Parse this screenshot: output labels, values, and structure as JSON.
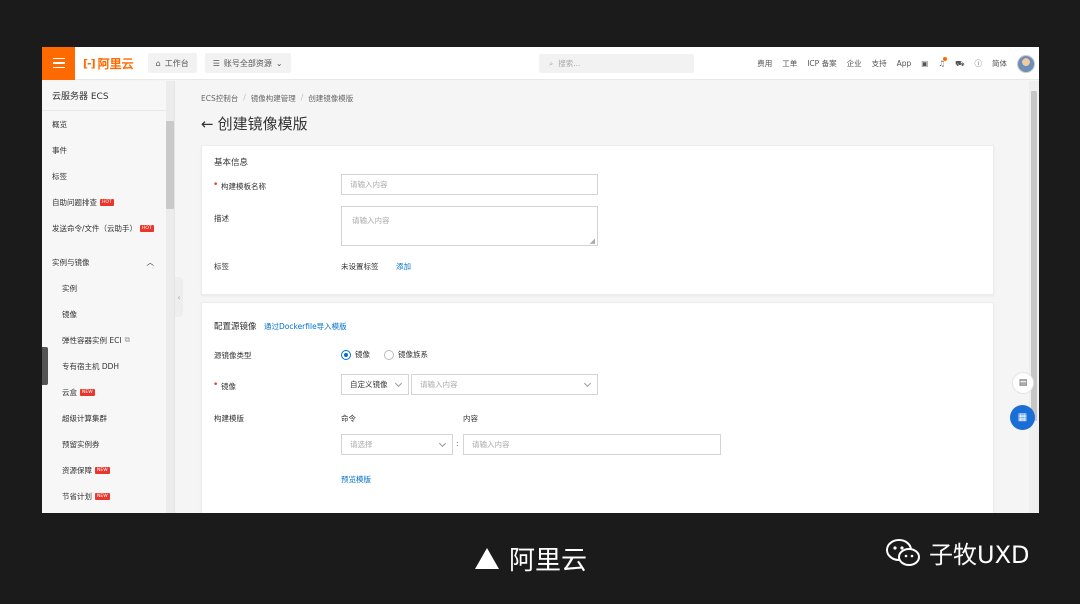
{
  "topbar": {
    "logo_text": "阿里云",
    "workbench": "工作台",
    "resources": "账号全部资源",
    "search_placeholder": "搜索...",
    "links": [
      "费用",
      "工单",
      "ICP 备案",
      "企业",
      "支持",
      "App"
    ],
    "lang": "简体"
  },
  "sidebar": {
    "title": "云服务器 ECS",
    "items": [
      {
        "label": "概览"
      },
      {
        "label": "事件"
      },
      {
        "label": "标签"
      },
      {
        "label": "自助问题排查",
        "badge": "HOT"
      },
      {
        "label": "发送命令/文件（云助手）",
        "badge": "HOT"
      }
    ],
    "group": "实例与镜像",
    "sub_items": [
      {
        "label": "实例"
      },
      {
        "label": "镜像"
      },
      {
        "label": "弹性容器实例 ECI"
      },
      {
        "label": "专有宿主机 DDH"
      },
      {
        "label": "云盒",
        "badge": "NEW"
      },
      {
        "label": "超级计算集群"
      },
      {
        "label": "预留实例券"
      },
      {
        "label": "资源保障",
        "badge": "NEW"
      },
      {
        "label": "节省计划",
        "badge": "NEW"
      }
    ]
  },
  "breadcrumb": [
    "ECS控制台",
    "镜像构建管理",
    "创建镜像模版"
  ],
  "page_title": "创建镜像模版",
  "basic": {
    "title": "基本信息",
    "name_label": "构建模板名称",
    "name_placeholder": "请输入内容",
    "desc_label": "描述",
    "desc_placeholder": "请输入内容",
    "tag_label": "标签",
    "tag_value": "未设置标签",
    "tag_add": "添加"
  },
  "source": {
    "title": "配置源镜像",
    "import_link": "通过Dockerfile导入模版",
    "type_label": "源镜像类型",
    "type_options": [
      "镜像",
      "镜像族系"
    ],
    "type_selected": "镜像",
    "image_label": "镜像",
    "image_select": "自定义镜像",
    "image_placeholder": "请输入内容",
    "template_label": "构建模版",
    "col_command": "命令",
    "col_content": "内容",
    "command_placeholder": "请选择",
    "content_placeholder": "请输入内容",
    "preview": "预览模版"
  },
  "caption": {
    "text": "阿里云",
    "watermark": "子牧UXD"
  }
}
